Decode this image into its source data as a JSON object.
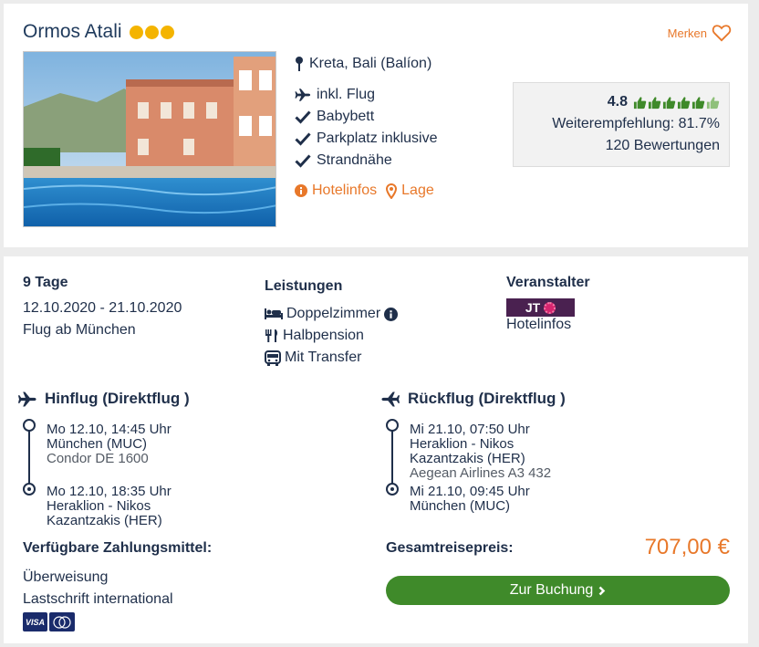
{
  "hotel": {
    "name": "Ormos Atali",
    "stars": 3,
    "star_color": "#f4b400",
    "merken_label": "Merken",
    "location": "Kreta, Bali (Balíon)",
    "features": [
      {
        "icon": "plane-icon",
        "label": "inkl. Flug"
      },
      {
        "icon": "check-icon",
        "label": "Babybett"
      },
      {
        "icon": "check-icon",
        "label": "Parkplatz inklusive"
      },
      {
        "icon": "check-icon",
        "label": "Strandnähe"
      }
    ],
    "links": {
      "hotelinfos": "Hotelinfos",
      "lage": "Lage"
    }
  },
  "rating": {
    "score": "4.8",
    "thumbs": 6,
    "recommendation": "Weiterempfehlung: 81.7%",
    "reviews": "120 Bewertungen"
  },
  "trip": {
    "duration": "9 Tage",
    "dates": "12.10.2020 - 21.10.2020",
    "departure_airport": "Flug ab München"
  },
  "services": {
    "heading": "Leistungen",
    "items": [
      {
        "icon": "bed-icon",
        "label": "Doppelzimmer"
      },
      {
        "icon": "cutlery-icon",
        "label": "Halbpension"
      },
      {
        "icon": "bus-icon",
        "label": "Mit Transfer"
      }
    ]
  },
  "operator": {
    "heading": "Veranstalter",
    "logo_text": "JT",
    "link": "Hotelinfos"
  },
  "outbound": {
    "heading": "Hinflug (Direktflug )",
    "dep_time": "Mo 12.10, 14:45 Uhr",
    "dep_airport": "München (MUC)",
    "carrier": "Condor DE 1600",
    "arr_time": "Mo 12.10, 18:35 Uhr",
    "arr_airport": "Heraklion - Nikos Kazantzakis (HER)"
  },
  "return": {
    "heading": "Rückflug (Direktflug )",
    "dep_time": "Mi 21.10, 07:50 Uhr",
    "dep_airport": "Heraklion - Nikos Kazantzakis (HER)",
    "carrier": "Aegean Airlines A3 432",
    "arr_time": "Mi 21.10, 09:45 Uhr",
    "arr_airport": "München (MUC)"
  },
  "payment": {
    "heading": "Verfügbare Zahlungsmittel:",
    "methods": [
      "Überweisung",
      "Lastschrift international"
    ],
    "visa_label": "VISA"
  },
  "price": {
    "label": "Gesamtreisepreis:",
    "total": "707,00 €",
    "book_label": "Zur Buchung"
  },
  "colors": {
    "accent": "#e8782a",
    "book_button": "#3f8a2a",
    "navy": "#1f2f4a"
  }
}
